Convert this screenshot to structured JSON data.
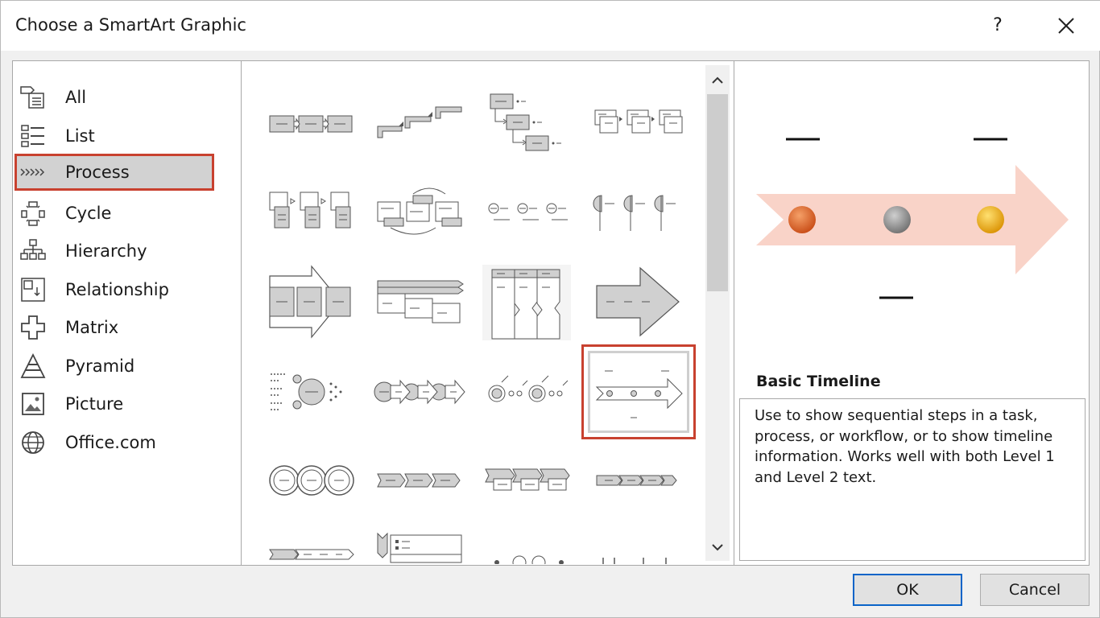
{
  "dialog": {
    "title": "Choose a SmartArt Graphic",
    "help_label": "?",
    "close_label": "close"
  },
  "categories": [
    {
      "label": "All",
      "icon": "all-icon"
    },
    {
      "label": "List",
      "icon": "list-icon"
    },
    {
      "label": "Process",
      "icon": "process-icon",
      "selected": true
    },
    {
      "label": "Cycle",
      "icon": "cycle-icon"
    },
    {
      "label": "Hierarchy",
      "icon": "hierarchy-icon"
    },
    {
      "label": "Relationship",
      "icon": "relationship-icon"
    },
    {
      "label": "Matrix",
      "icon": "matrix-icon"
    },
    {
      "label": "Pyramid",
      "icon": "pyramid-icon"
    },
    {
      "label": "Picture",
      "icon": "picture-icon"
    },
    {
      "label": "Office.com",
      "icon": "globe-icon"
    }
  ],
  "gallery": {
    "selected_tile": "Basic Timeline"
  },
  "preview": {
    "name": "Basic Timeline",
    "description": "Use to show sequential steps in a task, process, or workflow, or to show timeline information. Works well with both Level 1 and Level 2 text.",
    "colors": {
      "arrow": "#f9d3c8",
      "dot1": "#e0622a",
      "dot2": "#8a8a8a",
      "dot3": "#f0b418"
    }
  },
  "buttons": {
    "ok": "OK",
    "cancel": "Cancel"
  },
  "accent_color": "#c8412f"
}
